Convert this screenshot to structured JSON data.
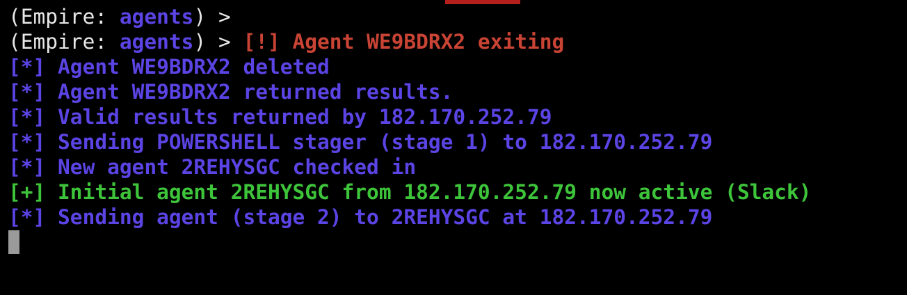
{
  "colors": {
    "prompt": "#e8e8e8",
    "agents": "#5a44e4",
    "info": "#5a44e4",
    "error": "#c94434",
    "success": "#3ec43a",
    "cursor": "#9a9a9a",
    "background": "#000000"
  },
  "prompt": {
    "open": "(Empire: ",
    "context": "agents",
    "close": ") > "
  },
  "lines": [
    {
      "message": ""
    },
    {
      "message": "[!] Agent WE9BDRX2 exiting"
    },
    {
      "message": "[*] Agent WE9BDRX2 deleted"
    },
    {
      "message": "[*] Agent WE9BDRX2 returned results."
    },
    {
      "message": "[*] Valid results returned by 182.170.252.79"
    },
    {
      "message": "[*] Sending POWERSHELL stager (stage 1) to 182.170.252.79"
    },
    {
      "message": "[*] New agent 2REHYSGC checked in"
    },
    {
      "message": "[+] Initial agent 2REHYSGC from 182.170.252.79 now active (Slack)"
    },
    {
      "message": "[*] Sending agent (stage 2) to 2REHYSGC at 182.170.252.79"
    }
  ]
}
